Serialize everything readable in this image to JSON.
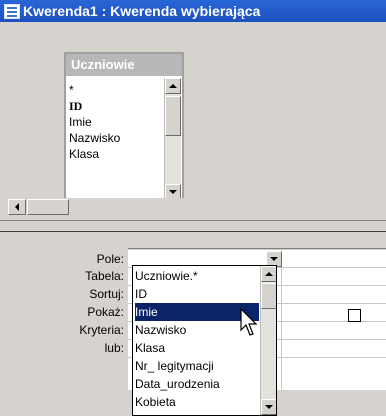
{
  "window": {
    "title": "Kwerenda1 : Kwerenda wybierająca"
  },
  "table_box": {
    "caption": "Uczniowie",
    "fields": [
      "*",
      "ID",
      "Imie",
      "Nazwisko",
      "Klasa"
    ]
  },
  "design_grid": {
    "row_labels": [
      "Pole:",
      "Tabela:",
      "Sortuj:",
      "Pokaż:",
      "Kryteria:",
      "lub:"
    ]
  },
  "dropdown": {
    "items": [
      "Uczniowie.*",
      "ID",
      "Imie",
      "Nazwisko",
      "Klasa",
      "Nr_ legitymacji",
      "Data_urodzenia",
      "Kobieta"
    ],
    "selected_index": 2
  },
  "colors": {
    "titlebar": "#1c4fbf",
    "selection": "#0a246a",
    "panel": "#d6d3ce"
  }
}
